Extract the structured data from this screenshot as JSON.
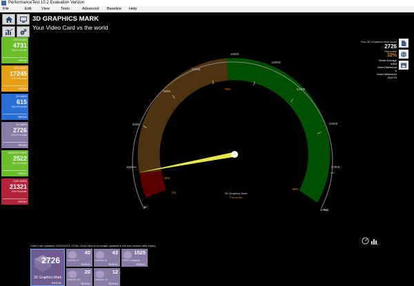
{
  "window": {
    "title": "PerformanceTest 10.2 Evaluation Version"
  },
  "menu": [
    "File",
    "Edit",
    "View",
    "Tests",
    "Advanced",
    "Baseline",
    "Help"
  ],
  "header": {
    "title": "3D GRAPHICS MARK",
    "subtitle": "Your Video Card vs the world"
  },
  "sidebar": [
    {
      "name": "PASSMARK",
      "value": "4731",
      "percentile": "85th Percentile",
      "rerun": "RERUN",
      "color": "#6abf2a"
    },
    {
      "name": "CPU MARK",
      "value": "17245",
      "percentile": "67th Percentile",
      "rerun": "RERUN",
      "color": "#e6a017"
    },
    {
      "name": "2D MARK",
      "value": "615",
      "percentile": "53rd Percentile",
      "rerun": "RERUN",
      "color": "#2a6fd6"
    },
    {
      "name": "3D MARK",
      "value": "2726",
      "percentile": "32nd Percentile",
      "rerun": "RERUN",
      "color": "#8a7aa6"
    },
    {
      "name": "MEMORY MARK",
      "value": "2522",
      "percentile": "46th Percentile",
      "rerun": "RERUN",
      "color": "#6abf2a"
    },
    {
      "name": "DISK MARK",
      "value": "21321",
      "percentile": "97th Percentile",
      "rerun": "RERUN",
      "color": "#b3243c"
    }
  ],
  "gauge": {
    "value": 2726,
    "max": 21000,
    "ticks": [
      "0",
      "3000",
      "6000",
      "9000",
      "12000",
      "15000",
      "18000",
      "21000",
      "24000",
      "27000",
      "30000"
    ],
    "percent_labels": [
      "1%",
      "25%",
      "75%",
      "99%"
    ],
    "center_label": "3D Graphics Mark",
    "center_sub": "Percentile",
    "colors": {
      "red": "#5a0000",
      "brown": "#4d3310",
      "green": "#005000",
      "needle": "#e8e84a",
      "pct_label": "#e67e22"
    }
  },
  "stats": {
    "score_label": "Your 3D Graphics Mark score",
    "score": "2726",
    "percentile_label": "Percentile",
    "percentile": "32%",
    "world_avg_label": "World Average",
    "world_avg": "8354",
    "world_min_label": "World Minimum",
    "world_min": "0",
    "world_max_label": "World Maximum",
    "world_max": "201075"
  },
  "chart_note": "Chart Last Updated: 2022/10/15, 23:04. Chart Data is no longer updated in the trial version after expiry",
  "tiles": {
    "main": {
      "value": "2726",
      "name": "3D Graphics Mark",
      "rerun": "RERUN"
    },
    "items": [
      {
        "value": "40",
        "name": "DirectX 9",
        "rerun": "RERUN"
      },
      {
        "value": "43",
        "name": "DirectX 11",
        "rerun": "RERUN"
      },
      {
        "value": "1525",
        "name": "GPU Compute",
        "rerun": "RERUN"
      },
      {
        "value": "20",
        "name": "DirectX 10",
        "rerun": "RERUN"
      },
      {
        "value": "12",
        "name": "DirectX 12",
        "rerun": "RERUN"
      }
    ]
  }
}
